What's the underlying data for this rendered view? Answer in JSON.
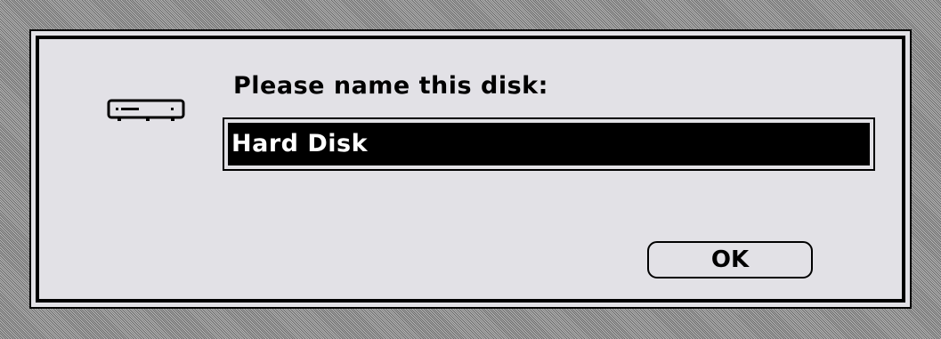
{
  "dialog": {
    "icon": "hard-disk-icon",
    "prompt": "Please name this disk:",
    "disk_name": "Hard Disk",
    "ok_label": "OK"
  },
  "colors": {
    "dialog_background": "#e2e1e6",
    "border": "#000000",
    "selection_background": "#000000",
    "selection_text": "#ffffff"
  }
}
